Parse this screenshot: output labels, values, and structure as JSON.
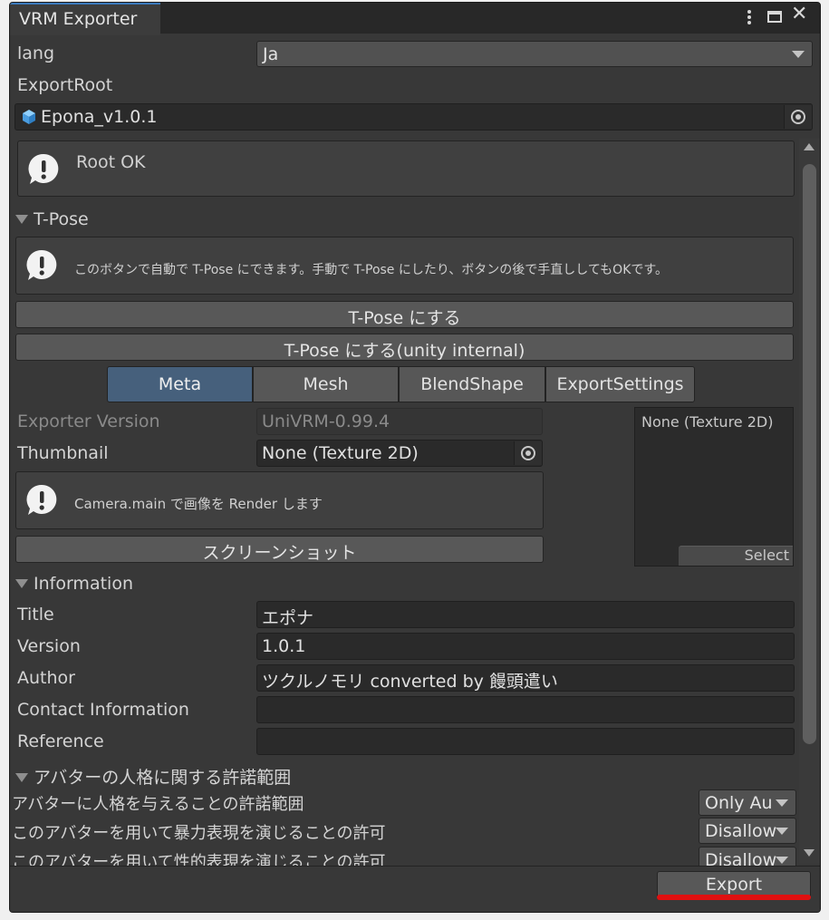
{
  "window": {
    "tab_title": "VRM Exporter"
  },
  "lang": {
    "label": "lang",
    "value": "Ja"
  },
  "export_root": {
    "label": "ExportRoot",
    "value": "Epona_v1.0.1",
    "icon": "prefab-cube-icon",
    "icon_color": "#5aa9e6"
  },
  "validation": {
    "message": "Root OK"
  },
  "tpose": {
    "header": "T-Pose",
    "help": "このボタンで自動で T-Pose にできます。手動で T-Pose にしたり、ボタンの後で手直ししてもOKです。",
    "button1": "T-Pose にする",
    "button2": "T-Pose にする(unity internal)"
  },
  "tabs": [
    {
      "label": "Meta",
      "active": true
    },
    {
      "label": "Mesh",
      "active": false
    },
    {
      "label": "BlendShape",
      "active": false
    },
    {
      "label": "ExportSettings",
      "active": false
    }
  ],
  "meta": {
    "exporter_version_label": "Exporter Version",
    "exporter_version_value": "UniVRM-0.99.4",
    "thumbnail_label": "Thumbnail",
    "thumbnail_value": "None (Texture 2D)",
    "thumbnail_preview_text": "None (Texture 2D)",
    "thumbnail_select": "Select",
    "camera_help": "Camera.main で画像を Render します",
    "screenshot_button": "スクリーンショット"
  },
  "information": {
    "header": "Information",
    "fields": [
      {
        "label": "Title",
        "value": "エポナ"
      },
      {
        "label": "Version",
        "value": "1.0.1"
      },
      {
        "label": "Author",
        "value": "ツクルノモリ converted by 饅頭遣い"
      },
      {
        "label": "Contact Information",
        "value": ""
      },
      {
        "label": "Reference",
        "value": ""
      }
    ]
  },
  "permissions": {
    "header": "アバターの人格に関する許諾範囲",
    "rows": [
      {
        "label": "アバターに人格を与えることの許諾範囲",
        "value": "Only Au"
      },
      {
        "label": "このアバターを用いて暴力表現を演じることの許可",
        "value": "Disallow"
      },
      {
        "label": "このアバターを用いて性的表現を演じることの許可",
        "value": "Disallow"
      }
    ]
  },
  "footer": {
    "export_button": "Export",
    "highlight_color": "#e01010"
  }
}
